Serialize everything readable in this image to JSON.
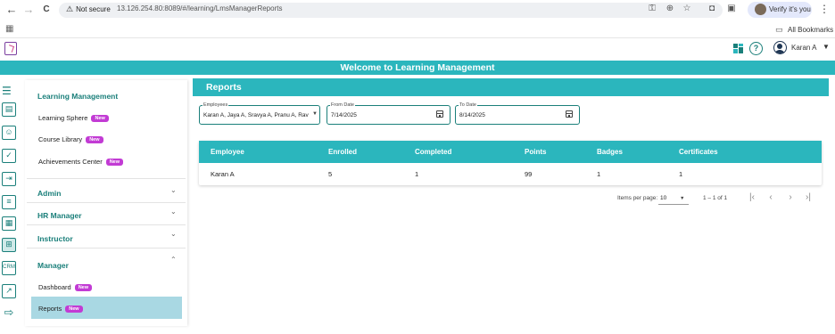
{
  "browser": {
    "back": "←",
    "forward": "→",
    "reload": "C",
    "security_label": "Not secure",
    "url": "13.126.254.80:8089/#/learning/LmsManagerReports",
    "verify_label": "Verify it's you",
    "bookmarks_label": "All Bookmarks"
  },
  "header": {
    "user_name": "Karan A",
    "welcome": "Welcome to Learning Management"
  },
  "side_menu": {
    "learning_management": {
      "title": "Learning Management",
      "items": [
        {
          "label": "Learning Sphere",
          "badge": "New"
        },
        {
          "label": "Course Library",
          "badge": "New"
        },
        {
          "label": "Achievements Center",
          "badge": "New"
        }
      ]
    },
    "sections": [
      {
        "label": "Admin"
      },
      {
        "label": "HR Manager"
      },
      {
        "label": "Instructor"
      },
      {
        "label": "Manager"
      }
    ],
    "manager_items": [
      {
        "label": "Dashboard",
        "badge": "New"
      },
      {
        "label": "Reports",
        "badge": "New",
        "active": true
      }
    ]
  },
  "reports": {
    "title": "Reports",
    "filters": {
      "employees": {
        "label": "Employees",
        "value": "Karan A, Jaya A, Sravya A, Pranu A, Ravi A..."
      },
      "from_date": {
        "label": "From Date",
        "value": "7/14/2025"
      },
      "to_date": {
        "label": "To Date",
        "value": "8/14/2025"
      }
    },
    "table": {
      "columns": [
        "Employee",
        "Enrolled",
        "Completed",
        "Points",
        "Badges",
        "Certificates"
      ],
      "rows": [
        [
          "Karan A",
          "5",
          "1",
          "99",
          "1",
          "1"
        ]
      ]
    },
    "pagination": {
      "items_per_page_label": "Items per page:",
      "items_per_page": "10",
      "range": "1 – 1 of 1"
    }
  },
  "colors": {
    "accent": "#2bb6bd",
    "accent_dark": "#1a7f7a",
    "badge": "#c23bd4",
    "active_item": "#a9d8e3"
  }
}
